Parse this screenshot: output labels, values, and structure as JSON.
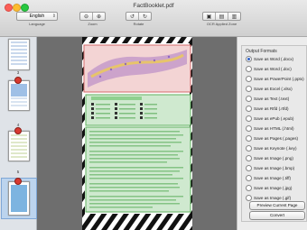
{
  "window": {
    "title": "FactBooklet.pdf"
  },
  "toolbar": {
    "language_value": "English",
    "language_label": "Language",
    "zoom_label": "Zoom",
    "rotate_label": "Rotate",
    "ocr_label": "OCR Applied Zone",
    "icons": [
      "zoom-out-icon",
      "zoom-in-icon",
      "rotate-left-icon",
      "rotate-right-icon",
      "ocr-zone-1-icon",
      "ocr-zone-2-icon",
      "ocr-zone-3-icon"
    ]
  },
  "sidebar": {
    "pages": [
      "3",
      "4",
      "5"
    ]
  },
  "output": {
    "heading": "Output Formats",
    "formats": [
      "Save as Word (.docx)",
      "Save as Word (.doc)",
      "Save as PowerPoint (.pptx)",
      "Save as Excel (.xlsx)",
      "Save as Text (.text)",
      "Save as Rtfd (.rtfd)",
      "Save as ePub (.epub)",
      "Save as HTML (.html)",
      "Save as Pages (.pages)",
      "Save as Keynote (.key)",
      "Save as Image (.png)",
      "Save as Image (.bmp)",
      "Save as Image (.tiff)",
      "Save as Image (.jpg)",
      "Save as Image (.gif)"
    ],
    "selected_index": 0,
    "preview_label": "Preview Current Page",
    "convert_label": "Convert"
  },
  "colors": {
    "accent": "#2b5fc9",
    "zone_red": "#e58a8a",
    "zone_green": "#8fd08f"
  }
}
